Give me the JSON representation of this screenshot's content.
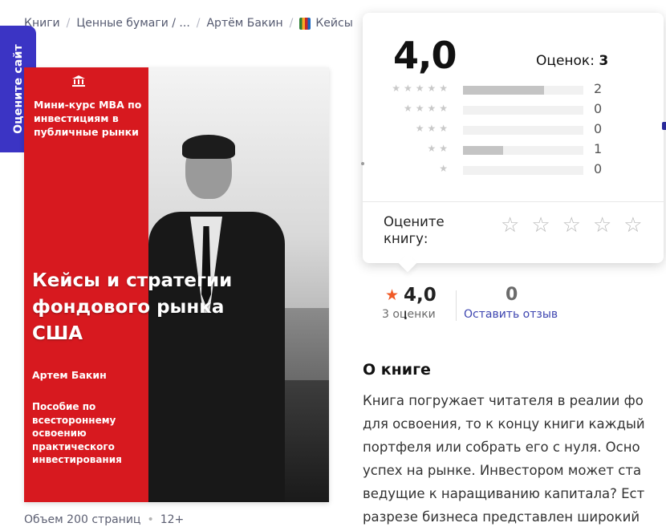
{
  "breadcrumb": [
    "Книги",
    "Ценные бумаги / ...",
    "Артём Бакин",
    "Кейсы"
  ],
  "side_tab": {
    "label": "Оцените сайт"
  },
  "cover": {
    "mba_text": "Мини-курс MBA по инвестициям в публичные рынки",
    "title": "Кейсы и стратегии фондового рынка США",
    "author": "Артем Бакин",
    "description": "Пособие по всестороннему освоению практического инвестирования"
  },
  "meta": {
    "pages": "Объем 200 страниц",
    "age": "12+"
  },
  "popup": {
    "rating": "4,0",
    "count_label": "Оценок:",
    "count_value": "3",
    "distribution": [
      {
        "stars": 5,
        "count": "2",
        "fraction": 0.67
      },
      {
        "stars": 4,
        "count": "0",
        "fraction": 0
      },
      {
        "stars": 3,
        "count": "0",
        "fraction": 0
      },
      {
        "stars": 2,
        "count": "1",
        "fraction": 0.33
      },
      {
        "stars": 1,
        "count": "0",
        "fraction": 0
      }
    ],
    "rate_prompt": "Оцените книгу:"
  },
  "summary": {
    "rating": "4,0",
    "ratings_count": "3 оценки",
    "reviews_count": "0",
    "leave_review": "Оставить отзыв"
  },
  "about": {
    "title": "О книге",
    "lines": [
      "Книга погружает читателя в реалии фо",
      "для освоения, то к концу книги каждый",
      "портфеля или собрать его с нуля. Осно",
      "успех на рынке. Инвестором может ста",
      "ведущие к наращиванию капитала? Ест",
      "разрезе бизнеса представлен широкий"
    ]
  },
  "colors": {
    "accent": "#3b34c4",
    "cover_red": "#d7191f",
    "star": "#f05a26",
    "link": "#3d45b0"
  }
}
